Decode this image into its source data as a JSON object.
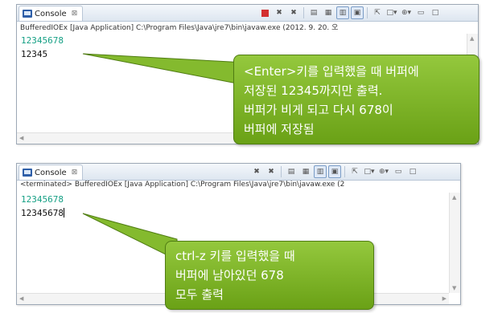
{
  "colors": {
    "input_text": "#16a085",
    "callout_fill": "#7cb32a",
    "callout_border": "#4f7c12"
  },
  "panel1": {
    "tab_label": "Console",
    "tab_close": "⊠",
    "process_label": "BufferedIOEx [Java Application] C:\\Program Files\\Java\\jre7\\bin\\javaw.exe (2012. 9. 20. 오",
    "lines": [
      "12345678",
      "12345"
    ],
    "callout_lines": [
      "<Enter>키를 입력했을 때 버퍼에",
      "저장된 12345까지만 출력.",
      "버퍼가 비게 되고 다시 678이",
      "버퍼에 저장됨"
    ]
  },
  "panel2": {
    "tab_label": "Console",
    "tab_close": "⊠",
    "process_label": "<terminated> BufferedIOEx [Java Application] C:\\Program Files\\Java\\jre7\\bin\\javaw.exe (2",
    "lines": [
      "12345678",
      "12345678"
    ],
    "callout_lines": [
      "ctrl-z 키를 입력했을 때",
      "버퍼에 남아있던 678",
      "모두 출력"
    ]
  }
}
